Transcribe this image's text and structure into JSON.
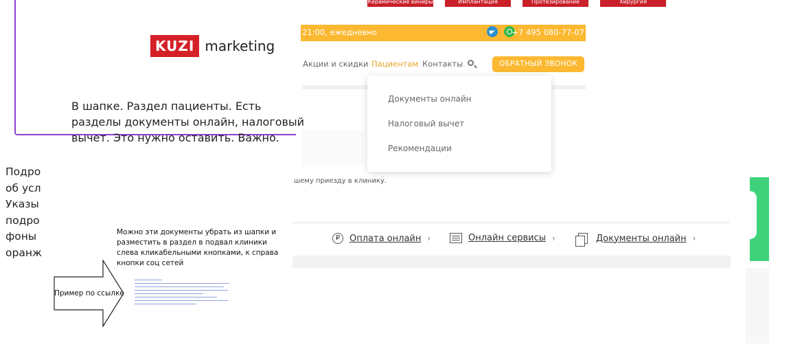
{
  "logo": {
    "box_text": "KUZI",
    "text": "marketing"
  },
  "main_note": "В шапке. Раздел пациенты. Есть разделы документы онлайн, налоговый вычет. Это нужно оставить. Важно.",
  "left_cut_lines": [
    "Подро",
    "об усл",
    "Указы",
    "подро",
    "фоны",
    "оранж"
  ],
  "top_tabs": [
    "Керамические виниры",
    "Имплантация",
    "Протезирование",
    "Хирургия"
  ],
  "topbar": {
    "hours": "21:00, ежедневно",
    "phone": "+7 495 080-77-07"
  },
  "nav": {
    "promo": "Акции и скидки",
    "patients": "Пациентам",
    "contacts": "Контакты",
    "callback": "ОБРАТНЫЙ ЗВОНОК"
  },
  "dropdown": [
    "Документы онлайн",
    "Налоговый вычет",
    "Рекомендации"
  ],
  "faint_text": "шему приезду в клинику.",
  "services": [
    {
      "icon": "ruble-icon",
      "label": "Оплата онлайн"
    },
    {
      "icon": "service-icon",
      "label": "Онлайн сервисы"
    },
    {
      "icon": "documents-icon",
      "label": "Документы онлайн"
    }
  ],
  "comment_note": "Можно эти документы убрать из шапки и разместить в раздел в подвал клиники слева кликабельными кнопками, к справа кнопки соц сетей",
  "arrow_label": "Пример по ссылке",
  "colors": {
    "accent": "#fbb830",
    "brand_red": "#d52027",
    "frame": "#8a3fd1"
  }
}
